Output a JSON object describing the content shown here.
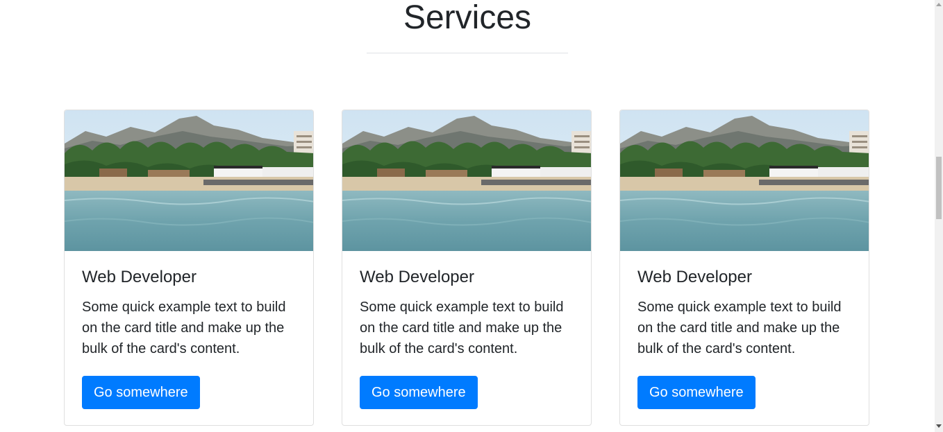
{
  "section": {
    "title": "Services"
  },
  "cards": [
    {
      "image": "beach-mountain-resort-photo",
      "title": "Web Developer",
      "text": "Some quick example text to build on the card title and make up the bulk of the card's content.",
      "button_label": "Go somewhere"
    },
    {
      "image": "beach-mountain-resort-photo",
      "title": "Web Developer",
      "text": "Some quick example text to build on the card title and make up the bulk of the card's content.",
      "button_label": "Go somewhere"
    },
    {
      "image": "beach-mountain-resort-photo",
      "title": "Web Developer",
      "text": "Some quick example text to build on the card title and make up the bulk of the card's content.",
      "button_label": "Go somewhere"
    }
  ],
  "colors": {
    "primary_button": "#007bff",
    "text": "#212529",
    "divider": "#dee2e6"
  }
}
